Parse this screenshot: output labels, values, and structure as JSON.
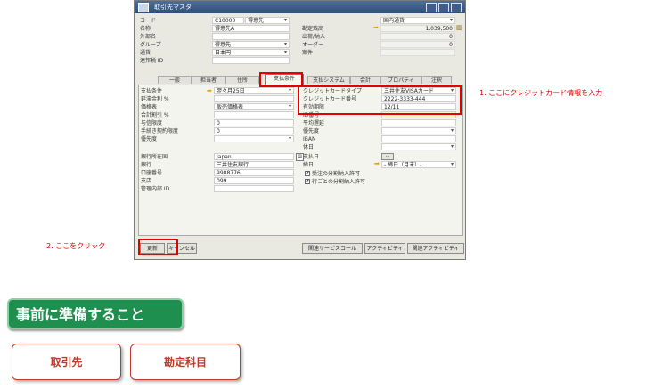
{
  "window": {
    "title": "取引先マスタ"
  },
  "header": {
    "code_label": "コード",
    "code_value": "C10000",
    "code_type": "得意先",
    "name_label": "名称",
    "name_value": "得意先A",
    "foreign_label": "外部名",
    "group_label": "グループ",
    "group_value": "得意先",
    "currency_label": "通貨",
    "currency_value": "日本円",
    "federal_label": "連邦税 ID",
    "currency_select": "国内通貨",
    "balance_label": "勘定残高",
    "balance_value": "1,039,500",
    "shipments_label": "出荷/納入",
    "shipments_value": "0",
    "orders_label": "オーダー",
    "orders_value": "0",
    "opportunities_label": "案件"
  },
  "tabs": [
    "一般",
    "担当者",
    "住所",
    "支払条件",
    "支払システム",
    "会計",
    "プロパティ",
    "注釈"
  ],
  "payment": {
    "terms_label": "支払条件",
    "terms_value": "翌々月25日",
    "interest_label": "延滞金利 %",
    "price_list_label": "価格表",
    "price_list_value": "販売価格表",
    "discount_label": "合計割引 %",
    "credit_limit_label": "与信限度",
    "credit_limit_value": "0",
    "commitment_label": "手続き契約限度",
    "commitment_value": "0",
    "priority_label": "優先度",
    "bank_country_label": "銀行所在国",
    "bank_country_value": "Japan",
    "bank_label": "銀行",
    "bank_value": "三井住友銀行",
    "account_label": "口座番号",
    "account_value": "9988776",
    "branch_label": "支店",
    "branch_value": "099",
    "control_label": "管理内部 ID",
    "cc_type_label": "クレジットカードタイプ",
    "cc_type_value": "三井住友VISAカード",
    "cc_number_label": "クレジットカード番号",
    "cc_number_value": "2222-3333-444",
    "expiry_label": "有効期限",
    "expiry_value": "12/11",
    "id_label": "ID番号",
    "avg_delay_label": "平均遅延",
    "pref_label": "優先度",
    "iban_label": "IBAN",
    "holidays_label": "休日",
    "pay_dates_label": "支払日",
    "closing_label": "締日",
    "closing_value": "- 締日（月末）-",
    "chk1_label": "受注の分割納入許可",
    "chk2_label": "行ごとの分割納入許可"
  },
  "buttons": {
    "update": "更新",
    "cancel": "キャンセル",
    "service_call": "関連サービスコール",
    "activity": "アクティビティ",
    "related_activity": "関連アクティビティ"
  },
  "annotations": {
    "step1": "1. ここにクレジットカード情報を入力",
    "step2": "2. ここをクリック",
    "prep": "事前に準備すること",
    "btn_partner": "取引先",
    "btn_account": "勘定科目"
  }
}
